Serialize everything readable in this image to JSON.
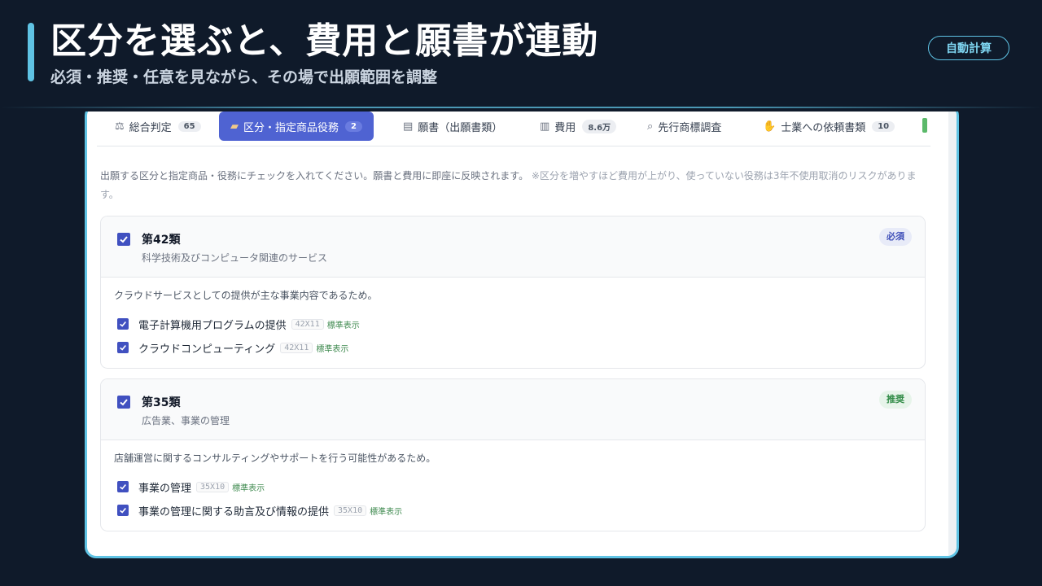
{
  "hero": {
    "title": "区分を選ぶと、費用と願書が連動",
    "subtitle": "必須・推奨・任意を見ながら、その場で出願範囲を調整",
    "badge": "自動計算"
  },
  "tabs": [
    {
      "icon": "scale-icon",
      "label": "総合判定",
      "count": "65"
    },
    {
      "icon": "tag-icon",
      "label": "区分・指定商品役務",
      "count": "2",
      "active": true
    },
    {
      "icon": "document-icon",
      "label": "願書（出願書類）"
    },
    {
      "icon": "chart-icon",
      "label": "費用",
      "count": "8.6万"
    },
    {
      "icon": "magnifier-icon",
      "label": "先行商標調査"
    },
    {
      "icon": "handshake-icon",
      "label": "士業への依頼書類",
      "count": "10"
    }
  ],
  "intro": {
    "main": "出願する区分と指定商品・役務にチェックを入れてください。願書と費用に即座に反映されます。",
    "note": "※区分を増やすほど費用が上がり、使っていない役務は3年不使用取消のリスクがあります。"
  },
  "classes": [
    {
      "name": "第42類",
      "desc": "科学技術及びコンピュータ関連のサービス",
      "tag": "必須",
      "tag_kind": "required",
      "reason": "クラウドサービスとしての提供が主な事業内容であるため。",
      "items": [
        {
          "label": "電子計算機用プログラムの提供",
          "code": "42X11",
          "std": "標準表示"
        },
        {
          "label": "クラウドコンピューティング",
          "code": "42X11",
          "std": "標準表示"
        }
      ]
    },
    {
      "name": "第35類",
      "desc": "広告業、事業の管理",
      "tag": "推奨",
      "tag_kind": "recommended",
      "reason": "店舗運営に関するコンサルティングやサポートを行う可能性があるため。",
      "items": [
        {
          "label": "事業の管理",
          "code": "35X10",
          "std": "標準表示"
        },
        {
          "label": "事業の管理に関する助言及び情報の提供",
          "code": "35X10",
          "std": "標準表示"
        }
      ]
    }
  ]
}
